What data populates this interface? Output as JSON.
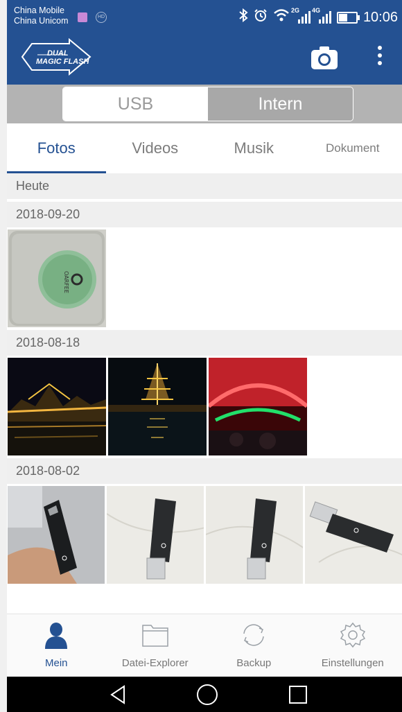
{
  "status_bar": {
    "carrier_1": "China Mobile",
    "carrier_2": "China Unicom",
    "hd_label": "HD",
    "net_1": "2G",
    "net_2": "4G",
    "time": "10:06",
    "icons": [
      "gallery-icon",
      "hd-icon",
      "bluetooth-icon",
      "alarm-icon",
      "wifi-icon",
      "signal-icon",
      "battery-icon"
    ]
  },
  "app_bar": {
    "logo_line_1": "DUAL",
    "logo_line_2": "MAGIC FLASH",
    "camera_icon": "camera-icon",
    "menu_icon": "more-vertical-icon",
    "color": "#245192"
  },
  "storage_toggle": {
    "options": [
      "USB",
      "Intern"
    ],
    "selected": "Intern"
  },
  "tabs": {
    "items": [
      "Fotos",
      "Videos",
      "Musik",
      "Dokument"
    ],
    "active": "Fotos"
  },
  "photo_groups": [
    {
      "date": "Heute",
      "photos": []
    },
    {
      "date": "2018-09-20",
      "photos": [
        "tin-box-photo"
      ]
    },
    {
      "date": "2018-08-18",
      "photos": [
        "night-bridge-photo",
        "night-tower-photo",
        "light-tunnel-photo"
      ]
    },
    {
      "date": "2018-08-02",
      "photos": [
        "flash-drive-in-hand-photo",
        "flash-drive-photo-1",
        "flash-drive-photo-2",
        "flash-drive-photo-3"
      ]
    }
  ],
  "bottom_nav": {
    "items": [
      {
        "label": "Mein",
        "icon": "person-icon"
      },
      {
        "label": "Datei-Explorer",
        "icon": "folder-icon"
      },
      {
        "label": "Backup",
        "icon": "sync-icon"
      },
      {
        "label": "Einstellungen",
        "icon": "gear-icon"
      }
    ],
    "active": "Mein"
  },
  "system_nav": {
    "icons": [
      "back-icon",
      "home-icon",
      "recents-icon"
    ]
  }
}
